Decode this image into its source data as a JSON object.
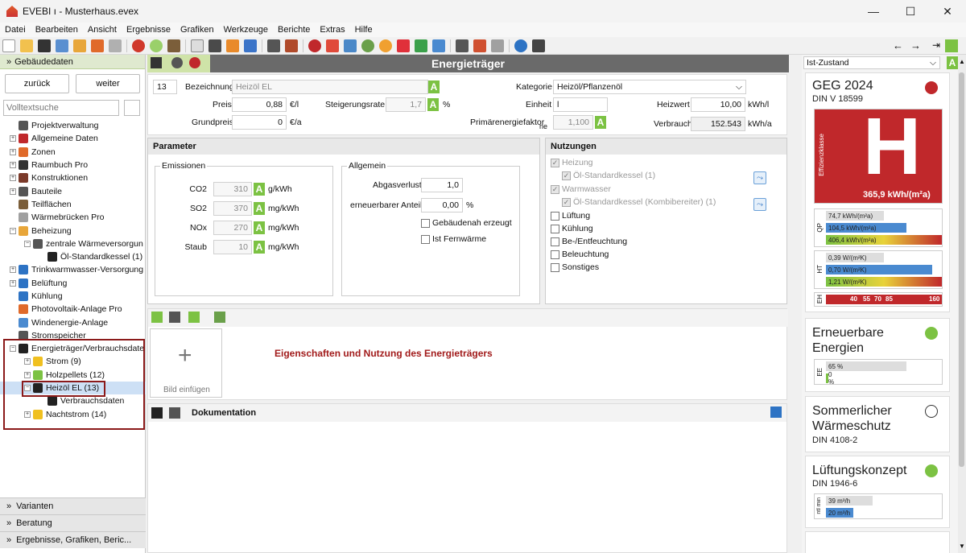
{
  "window": {
    "title": "EVEBI ı - Musterhaus.evex"
  },
  "menu": [
    "Datei",
    "Bearbeiten",
    "Ansicht",
    "Ergebnisse",
    "Grafiken",
    "Werkzeuge",
    "Berichte",
    "Extras",
    "Hilfe"
  ],
  "left": {
    "header": "Gebäudedaten",
    "back": "zurück",
    "forward": "weiter",
    "search_placeholder": "Volltextsuche",
    "tree": [
      {
        "label": "Projektverwaltung",
        "level": 0,
        "exp": ""
      },
      {
        "label": "Allgemeine Daten",
        "level": 0,
        "exp": "+"
      },
      {
        "label": "Zonen",
        "level": 0,
        "exp": "+"
      },
      {
        "label": "Raumbuch Pro",
        "level": 0,
        "exp": "+"
      },
      {
        "label": "Konstruktionen",
        "level": 0,
        "exp": "+"
      },
      {
        "label": "Bauteile",
        "level": 0,
        "exp": "+"
      },
      {
        "label": "Teilflächen",
        "level": 0,
        "exp": ""
      },
      {
        "label": "Wärmebrücken Pro",
        "level": 0,
        "exp": ""
      },
      {
        "label": "Beheizung",
        "level": 0,
        "exp": "-"
      },
      {
        "label": "zentrale Wärmeversorgun",
        "level": 1,
        "exp": "-"
      },
      {
        "label": "Öl-Standardkessel (1)",
        "level": 2,
        "exp": ""
      },
      {
        "label": "Trinkwarmwasser-Versorgung",
        "level": 0,
        "exp": "+"
      },
      {
        "label": "Belüftung",
        "level": 0,
        "exp": "+"
      },
      {
        "label": "Kühlung",
        "level": 0,
        "exp": ""
      },
      {
        "label": "Photovoltaik-Anlage Pro",
        "level": 0,
        "exp": ""
      },
      {
        "label": "Windenergie-Anlage",
        "level": 0,
        "exp": ""
      },
      {
        "label": "Stromspeicher",
        "level": 0,
        "exp": ""
      },
      {
        "label": "Energieträger/Verbrauchsdate",
        "level": 0,
        "exp": "-"
      },
      {
        "label": "Strom (9)",
        "level": 1,
        "exp": "+"
      },
      {
        "label": "Holzpellets (12)",
        "level": 1,
        "exp": "+"
      },
      {
        "label": "Heizöl EL (13)",
        "level": 1,
        "exp": "-"
      },
      {
        "label": "Verbrauchsdaten",
        "level": 2,
        "exp": ""
      },
      {
        "label": "Nachtstrom (14)",
        "level": 1,
        "exp": "+"
      }
    ],
    "bottom": [
      "Varianten",
      "Beratung",
      "Ergebnisse, Grafiken, Beric..."
    ]
  },
  "center": {
    "title": "Energieträger",
    "nr": "13",
    "bezeichnung_label": "Bezeichnung",
    "bezeichnung": "Heizöl EL",
    "kategorie_label": "Kategorie",
    "kategorie": "Heizöl/Pflanzenöl",
    "preis_label": "Preis",
    "preis": "0,88",
    "preis_unit": "€/l",
    "steigerung_label": "Steigerungsrate",
    "steigerung": "1,7",
    "steigerung_unit": "%",
    "einheit_label": "Einheit",
    "einheit": "l",
    "heizwert_label": "Heizwert",
    "heizwert": "10,00",
    "heizwert_unit": "kWh/l",
    "grundpreis_label": "Grundpreis",
    "grundpreis": "0",
    "grundpreis_unit": "€/a",
    "pef_label": "Primärenergiefaktor",
    "pef_sub": "ne",
    "pef": "1,100",
    "verbrauch_label": "Verbrauch",
    "verbrauch": "152.543",
    "verbrauch_unit": "kWh/a",
    "parameter": {
      "title": "Parameter",
      "emissionen": "Emissionen",
      "rows": [
        {
          "label": "CO2",
          "value": "310",
          "unit": "g/kWh"
        },
        {
          "label": "SO2",
          "value": "370",
          "unit": "mg/kWh"
        },
        {
          "label": "NOx",
          "value": "270",
          "unit": "mg/kWh"
        },
        {
          "label": "Staub",
          "value": "10",
          "unit": "mg/kWh"
        }
      ],
      "allgemein": "Allgemein",
      "abgas_label": "Abgasverlust",
      "abgas": "1,0",
      "ee_label": "erneuerbarer Anteil",
      "ee": "0,00",
      "ee_unit": "%",
      "cb1": "Gebäudenah erzeugt",
      "cb2": "Ist Fernwärme"
    },
    "nutzungen": {
      "title": "Nutzungen",
      "heizung": "Heizung",
      "heizung_sub": "Öl-Standardkessel (1)",
      "ww": "Warmwasser",
      "ww_sub": "Öl-Standardkessel (Kombibereiter) (1)",
      "items": [
        "Lüftung",
        "Kühlung",
        "Be-/Entfeuchtung",
        "Beleuchtung",
        "Sonstiges"
      ]
    },
    "bild": "Bild einfügen",
    "hint": "Eigenschaften und Nutzung des Energieträgers",
    "doku": "Dokumentation"
  },
  "right": {
    "zustand": "Ist-Zustand",
    "geg": {
      "title": "GEG 2024",
      "sub": "DIN V 18599",
      "klasse": "H",
      "klasse_label": "Effizienzklasse",
      "value": "365,9 kWh/(m²a)",
      "qp": [
        "74,7 kWh/(m²a)",
        "104,5 kWh/(m²a)",
        "406,4 kWh/(m²a)"
      ],
      "ht": [
        "0,39 W/(m²K)",
        "0,70 W/(m²K)",
        "1,21 W/(m²K)"
      ],
      "eh": [
        "40",
        "55",
        "70",
        "85",
        "160"
      ],
      "qp_label": "QP",
      "ht_label": "HT",
      "eh_label": "EH"
    },
    "ee": {
      "title": "Erneuerbare Energien",
      "vals": [
        "65 %",
        "0 %"
      ],
      "label": "EE"
    },
    "sws": {
      "title": "Sommerlicher Wärmeschutz",
      "sub": "DIN 4108-2"
    },
    "lk": {
      "title": "Lüftungskonzept",
      "sub": "DIN 1946-6",
      "vals": [
        "39 m³/h",
        "20 m³/h"
      ],
      "label": "ntl min"
    },
    "colors": {
      "red": "#c0282b",
      "green": "#7cc243"
    }
  }
}
